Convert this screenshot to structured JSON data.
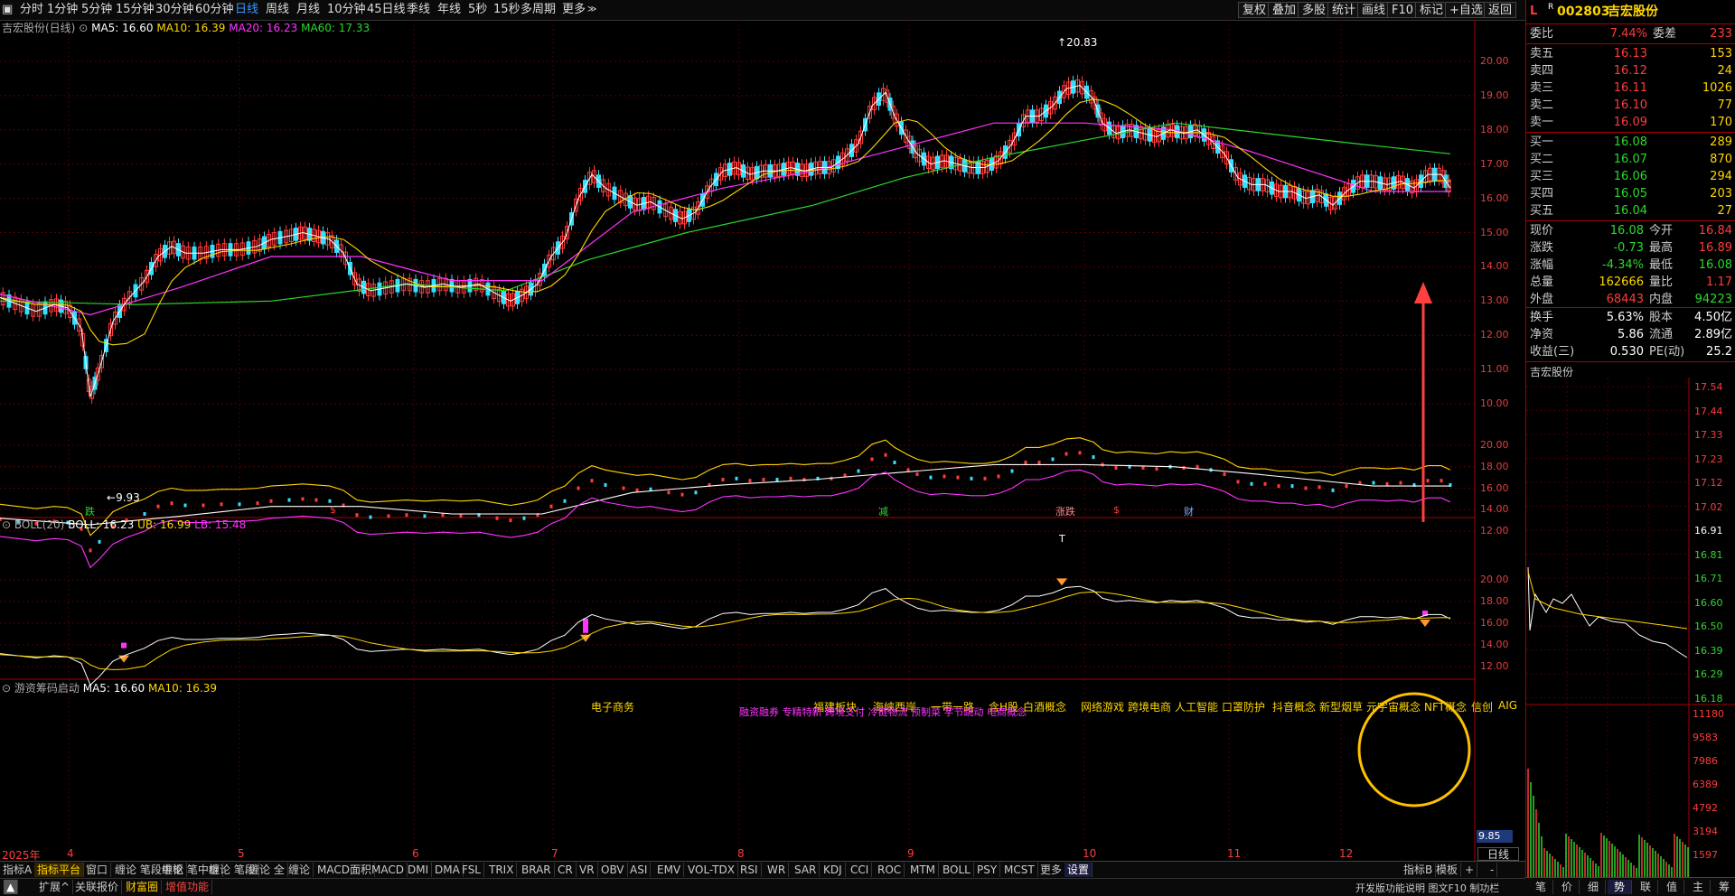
{
  "toolbar": {
    "timeframes": [
      "分时",
      "1分钟",
      "5分钟",
      "15分钟",
      "30分钟",
      "60分钟",
      "日线",
      "周线",
      "月线",
      "10分钟",
      "45日线",
      "季线",
      "年线",
      "5秒",
      "15秒",
      "多周期",
      "更多"
    ],
    "active_timeframe": "日线",
    "right_buttons": [
      "复权",
      "叠加",
      "多股",
      "统计",
      "画线",
      "F10",
      "标记",
      "+自选",
      "返回"
    ]
  },
  "main_chart": {
    "title": "吉宏股份(日线)",
    "ma5": "MA5: 16.60",
    "ma10": "MA10: 16.39",
    "ma20": "MA20: 16.23",
    "ma60": "MA60: 17.33",
    "high_label": "20.83",
    "low_label": "9.93",
    "y_ticks": [
      "20.00",
      "19.00",
      "18.00",
      "17.00",
      "16.00",
      "15.00",
      "14.00",
      "13.00",
      "12.00",
      "11.00",
      "10.00"
    ],
    "markers": [
      "跌",
      "$",
      "减",
      "涨跌",
      "$",
      "财"
    ]
  },
  "boll_panel": {
    "title": "BOLL(20)",
    "boll": "BOLL: 16.23",
    "ub": "UB: 16.99",
    "lb": "LB: 15.48",
    "marker": "T",
    "y_ticks": [
      "20.00",
      "18.00",
      "16.00",
      "14.00",
      "12.00"
    ]
  },
  "indicator_panel": {
    "title": "游资筹码启动",
    "ma5": "MA5: 16.60",
    "ma10": "MA10: 16.39",
    "y_ticks": [
      "20.00",
      "18.00",
      "16.00",
      "14.00",
      "12.00"
    ],
    "current_value": "9.85",
    "concept_top": "电子商务",
    "concepts_yellow": [
      "福建板块",
      "海峡西岸",
      "一带一路",
      "含H股",
      "白酒概念",
      "网络游戏",
      "跨境电商",
      "人工智能",
      "口罩防护",
      "抖音概念",
      "新型烟草",
      "元宇宙概念",
      "NFT概念",
      "信创",
      "AIG"
    ],
    "concepts_magenta": "融资融券 专精特新 跨境支付 冷链物流 预制菜 字节跳动 电商概念"
  },
  "x_axis": {
    "year": "2025年",
    "months": [
      "4",
      "5",
      "6",
      "7",
      "8",
      "9",
      "10",
      "11",
      "12"
    ]
  },
  "quote": {
    "flag": "L",
    "r_mark": "R",
    "code": "002803",
    "name": "吉宏股份",
    "weibi_label": "委比",
    "weibi_value": "7.44%",
    "weicha_label": "委差",
    "weicha_value": "233",
    "asks": [
      {
        "label": "卖五",
        "price": "16.13",
        "vol": "153"
      },
      {
        "label": "卖四",
        "price": "16.12",
        "vol": "24"
      },
      {
        "label": "卖三",
        "price": "16.11",
        "vol": "1026"
      },
      {
        "label": "卖二",
        "price": "16.10",
        "vol": "77"
      },
      {
        "label": "卖一",
        "price": "16.09",
        "vol": "170"
      }
    ],
    "bids": [
      {
        "label": "买一",
        "price": "16.08",
        "vol": "289"
      },
      {
        "label": "买二",
        "price": "16.07",
        "vol": "870"
      },
      {
        "label": "买三",
        "price": "16.06",
        "vol": "294"
      },
      {
        "label": "买四",
        "price": "16.05",
        "vol": "203"
      },
      {
        "label": "买五",
        "price": "16.04",
        "vol": "27"
      }
    ],
    "stats": [
      {
        "l1": "现价",
        "v1": "16.08",
        "c1": "#2bd92b",
        "l2": "今开",
        "v2": "16.84",
        "c2": "#ff3b3b"
      },
      {
        "l1": "涨跌",
        "v1": "-0.73",
        "c1": "#2bd92b",
        "l2": "最高",
        "v2": "16.89",
        "c2": "#ff3b3b"
      },
      {
        "l1": "涨幅",
        "v1": "-4.34%",
        "c1": "#2bd92b",
        "l2": "最低",
        "v2": "16.08",
        "c2": "#2bd92b"
      },
      {
        "l1": "总量",
        "v1": "162666",
        "c1": "#ffd700",
        "l2": "量比",
        "v2": "1.17",
        "c2": "#ff3b3b"
      },
      {
        "l1": "外盘",
        "v1": "68443",
        "c1": "#ff3b3b",
        "l2": "内盘",
        "v2": "94223",
        "c2": "#2bd92b"
      }
    ],
    "stats2": [
      {
        "l1": "换手",
        "v1": "5.63%",
        "l2": "股本",
        "v2": "4.50亿"
      },
      {
        "l1": "净资",
        "v1": "5.86",
        "l2": "流通",
        "v2": "2.89亿"
      },
      {
        "l1": "收益(三)",
        "v1": "0.530",
        "l2": "PE(动)",
        "v2": "25.2"
      }
    ]
  },
  "intraday": {
    "title": "吉宏股份",
    "price_ticks": [
      "17.54",
      "17.44",
      "17.33",
      "17.23",
      "17.12",
      "17.02",
      "16.91",
      "16.81",
      "16.71",
      "16.60",
      "16.50",
      "16.39",
      "16.29",
      "16.18"
    ],
    "vol_ticks": [
      "11180",
      "9583",
      "7986",
      "6389",
      "4792",
      "3194",
      "1597"
    ]
  },
  "bottom_tabs1": [
    "指标A",
    "指标平台",
    "窗口",
    "缠论 笔段中枢",
    "缠论 笔中枢",
    "缠论 笔段",
    "缠论 全",
    "缠论",
    "MACD面积",
    "MACD",
    "DMI",
    "DMA",
    "FSL",
    "TRIX",
    "BRAR",
    "CR",
    "VR",
    "OBV",
    "ASI",
    "EMV",
    "VOL-TDX",
    "RSI",
    "WR",
    "SAR",
    "KDJ",
    "CCI",
    "ROC",
    "MTM",
    "BOLL",
    "PSY",
    "MCST",
    "更多",
    "设置"
  ],
  "bottom_tabs1_right": [
    "指标B",
    "模板",
    "+",
    "-"
  ],
  "bottom_tabs2": [
    "扩展^",
    "关联报价",
    "财富圈",
    "增值功能"
  ],
  "period_label": "日线",
  "status_text": "开发版功能说明 图文F10 制功栏",
  "right_tabs": [
    "笔",
    "价",
    "细",
    "势",
    "联",
    "值",
    "主",
    "筹"
  ]
}
